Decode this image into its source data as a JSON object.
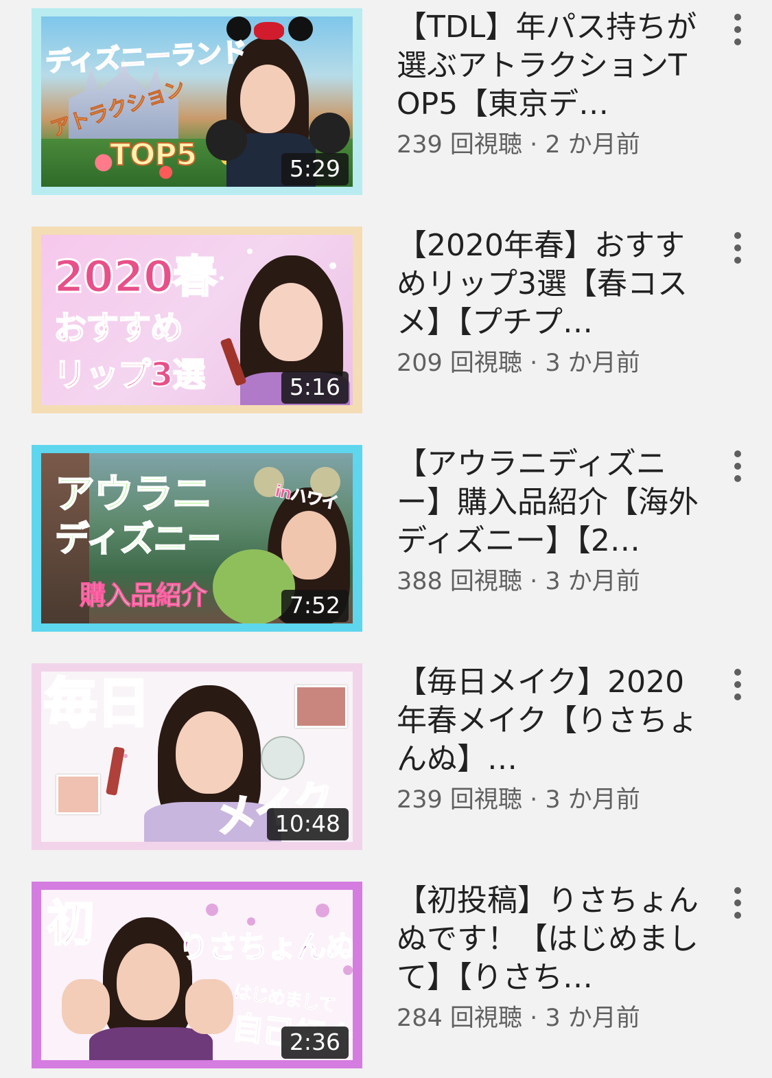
{
  "videos": [
    {
      "title": "【TDL】年パス持ちが選ぶアトラクションTOP5【東京デ…",
      "views": "239 回視聴",
      "age": "2 か月前",
      "duration": "5:29",
      "thumb_lines": [
        "ディズニーランド",
        "アトラクション",
        "TOP5"
      ],
      "border_color": "#b8ecf0"
    },
    {
      "title": "【2020年春】おすすめリップ3選【春コスメ】【プチプ…",
      "views": "209 回視聴",
      "age": "3 か月前",
      "duration": "5:16",
      "thumb_lines": [
        "2020春",
        "おすすめ",
        "リップ3選"
      ],
      "border_color": "#f4dcb4"
    },
    {
      "title": "【アウラニディズニー】購入品紹介【海外ディズニー】【2…",
      "views": "388 回視聴",
      "age": "3 か月前",
      "duration": "7:52",
      "thumb_lines": [
        "アウラニ",
        "ディズニー",
        "購入品紹介",
        "inハワイ"
      ],
      "border_color": "#5dd6ee"
    },
    {
      "title": "【毎日メイク】2020年春メイク【りさちょんぬ】…",
      "views": "239 回視聴",
      "age": "3 か月前",
      "duration": "10:48",
      "thumb_lines": [
        "毎日",
        "メイク"
      ],
      "border_color": "#f2d4ea"
    },
    {
      "title": "【初投稿】りさちょんぬです！【はじめまして】【りさち…",
      "views": "284 回視聴",
      "age": "3 か月前",
      "duration": "2:36",
      "thumb_lines": [
        "初",
        "りさちょんぬ",
        "はじめまして",
        "自己紹介"
      ],
      "border_color": "#d57ce0"
    }
  ],
  "meta_separator": " · ",
  "icons": {
    "menu": "more-vert-icon"
  }
}
